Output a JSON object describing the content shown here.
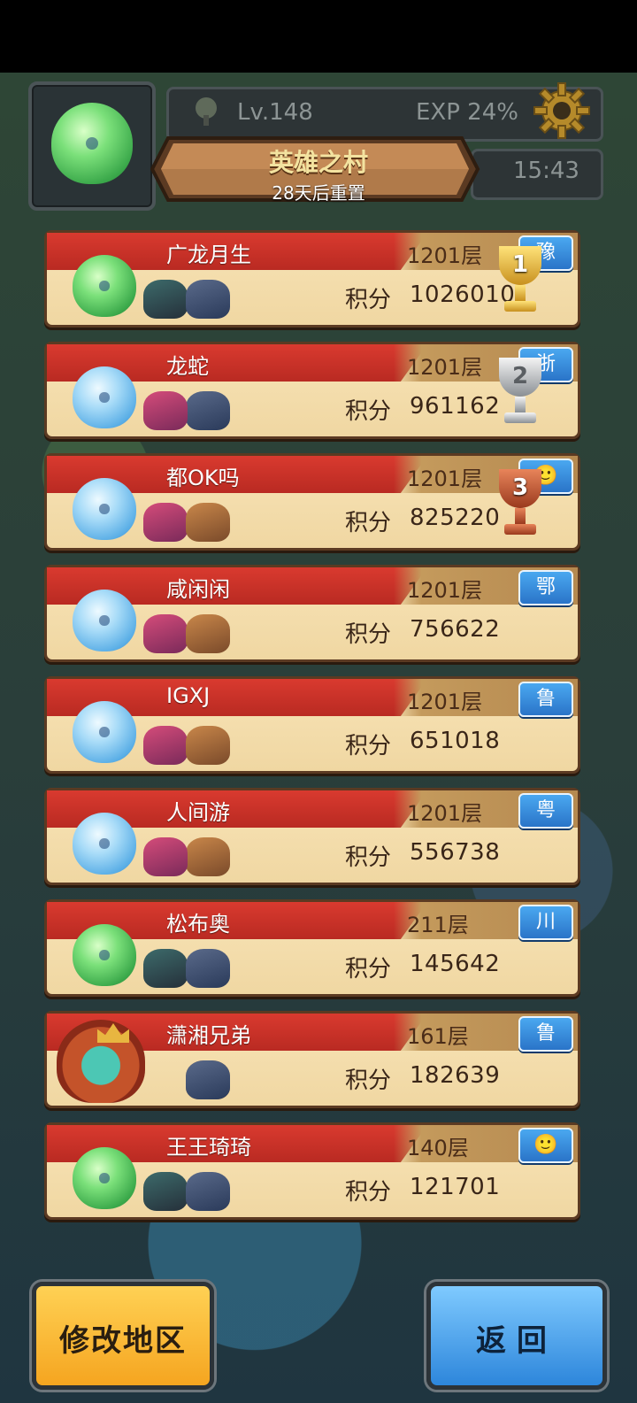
{
  "header": {
    "level": "Lv.148",
    "exp": "EXP 24%",
    "timer": "15:43",
    "title": "英雄之村",
    "subtitle": "28天后重置"
  },
  "ranking": [
    {
      "name": "广龙月生",
      "floor": "1201层",
      "score_label": "积分",
      "score": "1026010",
      "region": "豫",
      "slime": "green",
      "trophy": "1"
    },
    {
      "name": "龙蛇",
      "floor": "1201层",
      "score_label": "积分",
      "score": "961162",
      "region": "浙",
      "slime": "blue",
      "trophy": "2"
    },
    {
      "name": "都OK吗",
      "floor": "1201层",
      "score_label": "积分",
      "score": "825220",
      "region": "🙂",
      "slime": "blue",
      "trophy": "3"
    },
    {
      "name": "咸闲闲",
      "floor": "1201层",
      "score_label": "积分",
      "score": "756622",
      "region": "鄂",
      "slime": "blue"
    },
    {
      "name": "IGXJ",
      "floor": "1201层",
      "score_label": "积分",
      "score": "651018",
      "region": "鲁",
      "slime": "blue"
    },
    {
      "name": "人间游",
      "floor": "1201层",
      "score_label": "积分",
      "score": "556738",
      "region": "粤",
      "slime": "blue"
    },
    {
      "name": "松布奥",
      "floor": "211层",
      "score_label": "积分",
      "score": "145642",
      "region": "川",
      "slime": "green"
    },
    {
      "name": "潇湘兄弟",
      "floor": "161层",
      "score_label": "积分",
      "score": "182639",
      "region": "鲁",
      "slime": "hero"
    },
    {
      "name": "王王琦琦",
      "floor": "140层",
      "score_label": "积分",
      "score": "121701",
      "region": "🙂",
      "slime": "green"
    }
  ],
  "buttons": {
    "change_region": "修改地区",
    "back": "返回"
  },
  "colors": {
    "name_strip": "#c9322a",
    "card_body": "#f3dcaa",
    "region_badge": "#3a8de0",
    "change_region_button": "#f7b630",
    "back_button": "#4aa6ef"
  }
}
